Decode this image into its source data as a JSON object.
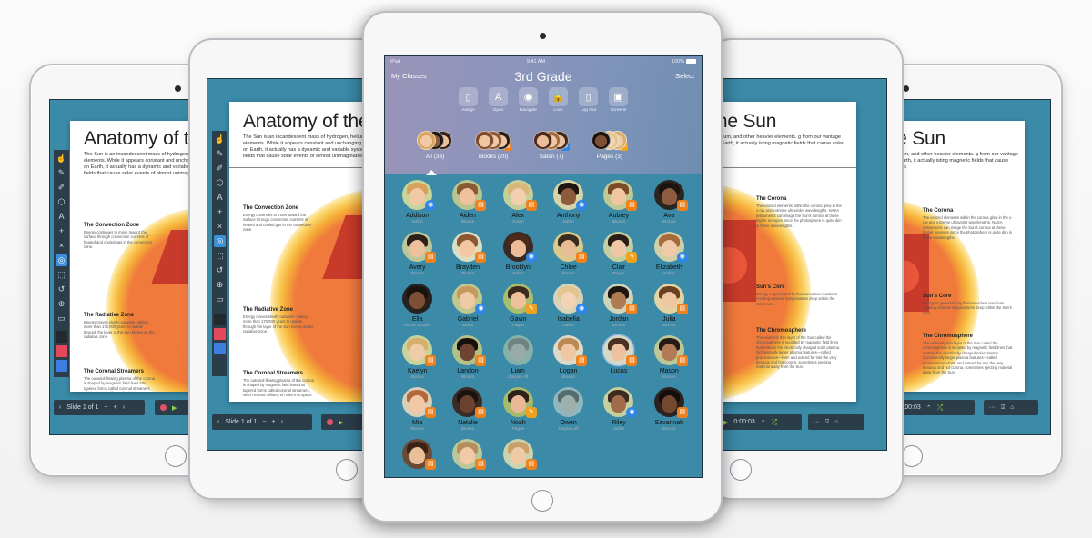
{
  "scene": {
    "description": "Five iPads showing Keynote slides and the Classroom app"
  },
  "center_ipad": {
    "status_bar": {
      "carrier": "iPad",
      "time": "9:41 AM",
      "battery": "100%"
    },
    "nav": {
      "back_label": "My Classes",
      "title": "3rd Grade",
      "select_label": "Select"
    },
    "actions": [
      {
        "label": "Assign",
        "icon": "assign-icon",
        "glyph": "▯"
      },
      {
        "label": "Open",
        "icon": "app-store-icon",
        "glyph": "A"
      },
      {
        "label": "Navigate",
        "icon": "compass-icon",
        "glyph": "◉"
      },
      {
        "label": "Lock",
        "icon": "lock-icon",
        "glyph": "🔒"
      },
      {
        "label": "Log Out",
        "icon": "logout-icon",
        "glyph": "▯"
      },
      {
        "label": "Screens",
        "icon": "screens-icon",
        "glyph": "▣"
      }
    ],
    "groups": [
      {
        "label": "All (33)",
        "badge": "",
        "selected": true
      },
      {
        "label": "iBooks (20)",
        "badge": "ibooks"
      },
      {
        "label": "Safari (7)",
        "badge": "safari"
      },
      {
        "label": "Pages (3)",
        "badge": "pages"
      }
    ],
    "students": [
      {
        "name": "Addison",
        "app": "Safari",
        "badge": "safari",
        "skin": "#f1c9a5",
        "hair": "#d9a25c",
        "bg": "#c9d49a"
      },
      {
        "name": "Aiden",
        "app": "iBooks",
        "badge": "ibooks",
        "skin": "#efc19c",
        "hair": "#8a5a32",
        "bg": "#b9c58f"
      },
      {
        "name": "Alex",
        "app": "Safari",
        "badge": "ibooks",
        "skin": "#f2cfae",
        "hair": "#d7b77a",
        "bg": "#c5cf9a"
      },
      {
        "name": "Anthony",
        "app": "Safari",
        "badge": "safari",
        "skin": "#8c5a3c",
        "hair": "#1d1613",
        "bg": "#d8d3a8"
      },
      {
        "name": "Aubrey",
        "app": "iBooks",
        "badge": "ibooks",
        "skin": "#f0c6a0",
        "hair": "#7d4a2a",
        "bg": "#c0c992"
      },
      {
        "name": "Ava",
        "app": "iBooks",
        "badge": "ibooks",
        "skin": "#8d5b3d",
        "hair": "#1b1412",
        "bg": "#2b2522"
      },
      {
        "name": "Avery",
        "app": "iBooks",
        "badge": "ibooks",
        "skin": "#eec19d",
        "hair": "#2e2019",
        "bg": "#bcc79a"
      },
      {
        "name": "Brayden",
        "app": "iBooks",
        "badge": "ibooks",
        "skin": "#f2c7a2",
        "hair": "#8c5833",
        "bg": "#dadfc3"
      },
      {
        "name": "Brooklyn",
        "app": "Safari",
        "badge": "safari",
        "skin": "#eabd98",
        "hair": "#4d2a1c",
        "bg": "#3b2a24"
      },
      {
        "name": "Chloe",
        "app": "iBooks",
        "badge": "ibooks",
        "skin": "#e8bd96",
        "hair": "#3a2a1f",
        "bg": "#d9c98a"
      },
      {
        "name": "Clair",
        "app": "Pages",
        "badge": "pages",
        "skin": "#efc7a4",
        "hair": "#2b1d15",
        "bg": "#c4cfa1"
      },
      {
        "name": "Elizabeth",
        "app": "Safari",
        "badge": "safari",
        "skin": "#f1caa8",
        "hair": "#a56a3a",
        "bg": "#cfcfa8"
      },
      {
        "name": "Ella",
        "app": "Home Screen",
        "badge": "",
        "skin": "#7f4f35",
        "hair": "#1a1310",
        "bg": "#262220"
      },
      {
        "name": "Gabriel",
        "app": "Safari",
        "badge": "safari",
        "skin": "#f0c9a6",
        "hair": "#c59a5f",
        "bg": "#bec88f"
      },
      {
        "name": "Gavin",
        "app": "Pages",
        "badge": "pages",
        "skin": "#eec19a",
        "hair": "#3b2a1d",
        "bg": "#a9bd6d"
      },
      {
        "name": "Isabella",
        "app": "Safari",
        "badge": "safari",
        "skin": "#f3d3b5",
        "hair": "#e1c58e",
        "bg": "#d8d2b8"
      },
      {
        "name": "Jordan",
        "app": "iBooks",
        "badge": "ibooks",
        "skin": "#b07a54",
        "hair": "#1e1612",
        "bg": "#cfd3b8"
      },
      {
        "name": "Julia",
        "app": "iBooks",
        "badge": "ibooks",
        "skin": "#eec6a2",
        "hair": "#6a3f22",
        "bg": "#e3d3a3"
      },
      {
        "name": "Kaelyn",
        "app": "iBooks",
        "badge": "ibooks",
        "skin": "#f0cba8",
        "hair": "#d7ae6b",
        "bg": "#c8d39b"
      },
      {
        "name": "Landon",
        "app": "iBooks",
        "badge": "ibooks",
        "skin": "#6d4530",
        "hair": "#17110e",
        "bg": "#b3c189"
      },
      {
        "name": "Liam",
        "app": "Display off",
        "badge": "",
        "skin": "#e5c6a9",
        "hair": "#9b8063",
        "bg": "#c5cfa8",
        "dim": true
      },
      {
        "name": "Logan",
        "app": "iBooks",
        "badge": "ibooks",
        "skin": "#f0c7a3",
        "hair": "#b98a52",
        "bg": "#dfd9c9"
      },
      {
        "name": "Lucas",
        "app": "AirPlay",
        "badge": "ibooks",
        "skin": "#eec29f",
        "hair": "#4a3222",
        "bg": "#d5d9c5",
        "airplay": true
      },
      {
        "name": "Mason",
        "app": "iBooks",
        "badge": "ibooks",
        "skin": "#b37b55",
        "hair": "#251a14",
        "bg": "#bcc697"
      },
      {
        "name": "Mia",
        "app": "iBooks",
        "badge": "ibooks",
        "skin": "#f2c7a5",
        "hair": "#b2683b",
        "bg": "#d9cfb8"
      },
      {
        "name": "Natalie",
        "app": "iBooks",
        "badge": "ibooks",
        "skin": "#6b4230",
        "hair": "#1b1310",
        "bg": "#3a2c24"
      },
      {
        "name": "Noah",
        "app": "Pages",
        "badge": "pages",
        "skin": "#e8b994",
        "hair": "#2c2019",
        "bg": "#a6ba6a"
      },
      {
        "name": "Owen",
        "app": "Display off",
        "badge": "",
        "skin": "#eecfb3",
        "hair": "#6a5442",
        "bg": "#d8ddcf",
        "dim": true
      },
      {
        "name": "Riley",
        "app": "Safari",
        "badge": "safari",
        "skin": "#a06c4b",
        "hair": "#3b2a1f",
        "bg": "#c7cf9f"
      },
      {
        "name": "Savannah",
        "app": "iBooks",
        "badge": "ibooks",
        "skin": "#74472f",
        "hair": "#130d0b",
        "bg": "#2b2320"
      },
      {
        "name": "",
        "app": "",
        "badge": "ibooks",
        "skin": "#e9bf9a",
        "hair": "#3a2418",
        "bg": "#6a4a35"
      },
      {
        "name": "",
        "app": "",
        "badge": "ibooks",
        "skin": "#f1cba8",
        "hair": "#b48e5c",
        "bg": "#bcc79a"
      },
      {
        "name": "",
        "app": "",
        "badge": "ibooks",
        "skin": "#f0caa7",
        "hair": "#c7a06a",
        "bg": "#cbd2ae"
      }
    ]
  },
  "keynote": {
    "title_left": "Anatomy of the",
    "title_right": "f the Sun",
    "title_far_right": "the Sun",
    "intro_left": "The Sun is an incandescent mass of hydrogen, helium, and other heavier elements. While it appears constant and unchanging from our vantage point on Earth, it actually has a dynamic and variable system of twisting magnetic fields that cause solar events of almost unimaginable power.",
    "intro_right": "ogen, helium, and other heavier elements. g from our vantage point on Earth, it actually isting magnetic fields that cause solar events",
    "sections_left": [
      {
        "heading": "The Convection Zone",
        "body": "Energy continues to move toward the surface through convection currents of heated and cooled gas in the convection zone."
      },
      {
        "heading": "The Radiative Zone",
        "body": "Energy moves slowly outward—taking more than 170,000 years to radiate through the layer of the Sun known as the radiative zone."
      },
      {
        "heading": "The Coronal Streamers",
        "body": "The outward-flowing plasma of the corona is shaped by magnetic field lines into tapered forms called coronal streamers, which extend millions of miles into space."
      }
    ],
    "sections_right": [
      {
        "heading": "The Corona",
        "body": "The ionized elements within the corona glow in the x-ray and extreme ultraviolet wavelengths. NASA instruments can image the Sun's corona at these higher energies since the photosphere is quite dim in these wavelengths."
      },
      {
        "heading": "Sun's Core",
        "body": "Energy is generated by thermonuclear reactions creating extreme temperatures deep within the Sun's core."
      },
      {
        "heading": "The Chromosphere",
        "body": "The relatively thin layer of the Sun called the chromosphere is sculpted by magnetic field lines that restrain the electrically charged solar plasma. Occasionally larger plasma features—called prominences—form and extend far into the very tenuous and hot corona, sometimes ejecting material away from the Sun."
      }
    ],
    "slide_nav": {
      "label": "Slide 1 of 1",
      "prev": "‹",
      "next": "›",
      "minus": "−",
      "plus": "+"
    },
    "timer": "0:00:03",
    "more": "···",
    "tools": [
      "☝",
      "✎",
      "✐",
      "⬡",
      "A",
      "+",
      "×",
      "◎",
      "⬚",
      "↺",
      "⊕",
      "▭"
    ],
    "colors": [
      "#222a30",
      "#e5485a",
      "#3d7fe0"
    ]
  },
  "colors": {
    "keynote_bg": "#3b8aa8",
    "toolbar": "#2c3d4a",
    "safari_badge": "#2f86e6",
    "ibooks_badge": "#f0821e",
    "pages_badge": "#f0a21e"
  }
}
